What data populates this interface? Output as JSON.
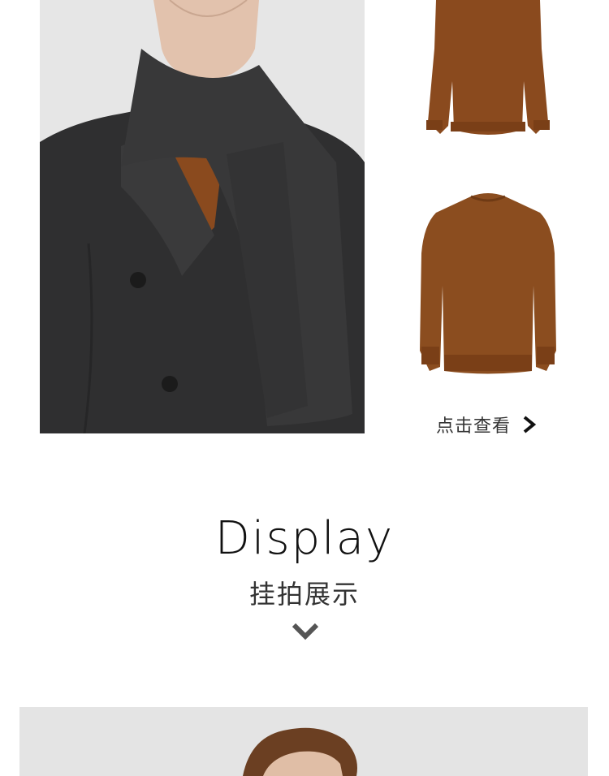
{
  "top_section": {
    "model_photo_alt": "model-wearing-coat-scarf-and-sweater",
    "products": [
      {
        "name_icon": "sweater-front-icon",
        "color": "#8a4a1e"
      },
      {
        "name_icon": "sweater-mockneck-icon",
        "color": "#8b4d1f"
      }
    ],
    "view_link": {
      "label": "点击查看",
      "icon": "chevron-right-icon"
    }
  },
  "display_section": {
    "title": "Display",
    "subtitle": "挂拍展示",
    "icon": "chevron-down-icon"
  },
  "colors": {
    "coat": "#2f2f30",
    "sweater": "#8a4a1e",
    "background_gray": "#e8e8e8",
    "text_dark": "#111111"
  }
}
